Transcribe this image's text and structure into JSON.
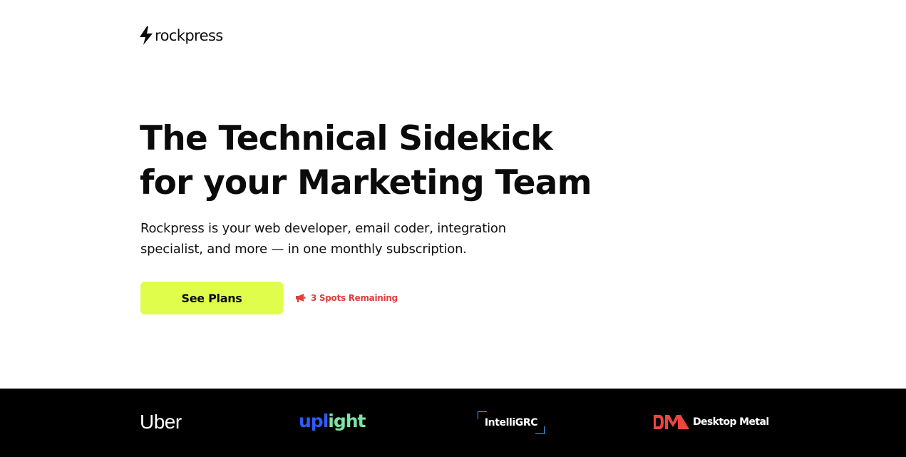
{
  "header": {
    "logo_text": "rockpress",
    "logo_icon": "lightning-bolt-icon"
  },
  "hero": {
    "title_line1": "The Technical Sidekick",
    "title_line2": "for your Marketing Team",
    "subtitle_line1": "Rockpress is your web developer, email coder, integration",
    "subtitle_line2": "specialist, and more — in one monthly subscription.",
    "cta_label": "See Plans",
    "spots_icon": "megaphone-icon",
    "spots_text": "3 Spots Remaining"
  },
  "clients": {
    "uber": "Uber",
    "uplight_a": "upl",
    "uplight_b": "i",
    "uplight_c": "ght",
    "intelligrc": "IntelliGRC",
    "desktop_metal": "Desktop Metal"
  },
  "colors": {
    "cta_background": "#e1fd4c",
    "spots_text": "#e0403e",
    "logo_band": "#000000",
    "uplight_blue": "#2f5bff",
    "uplight_green": "#7de3a3",
    "intelligrc_accent": "#4aa3ff",
    "desktop_metal_red": "#f0443f"
  }
}
